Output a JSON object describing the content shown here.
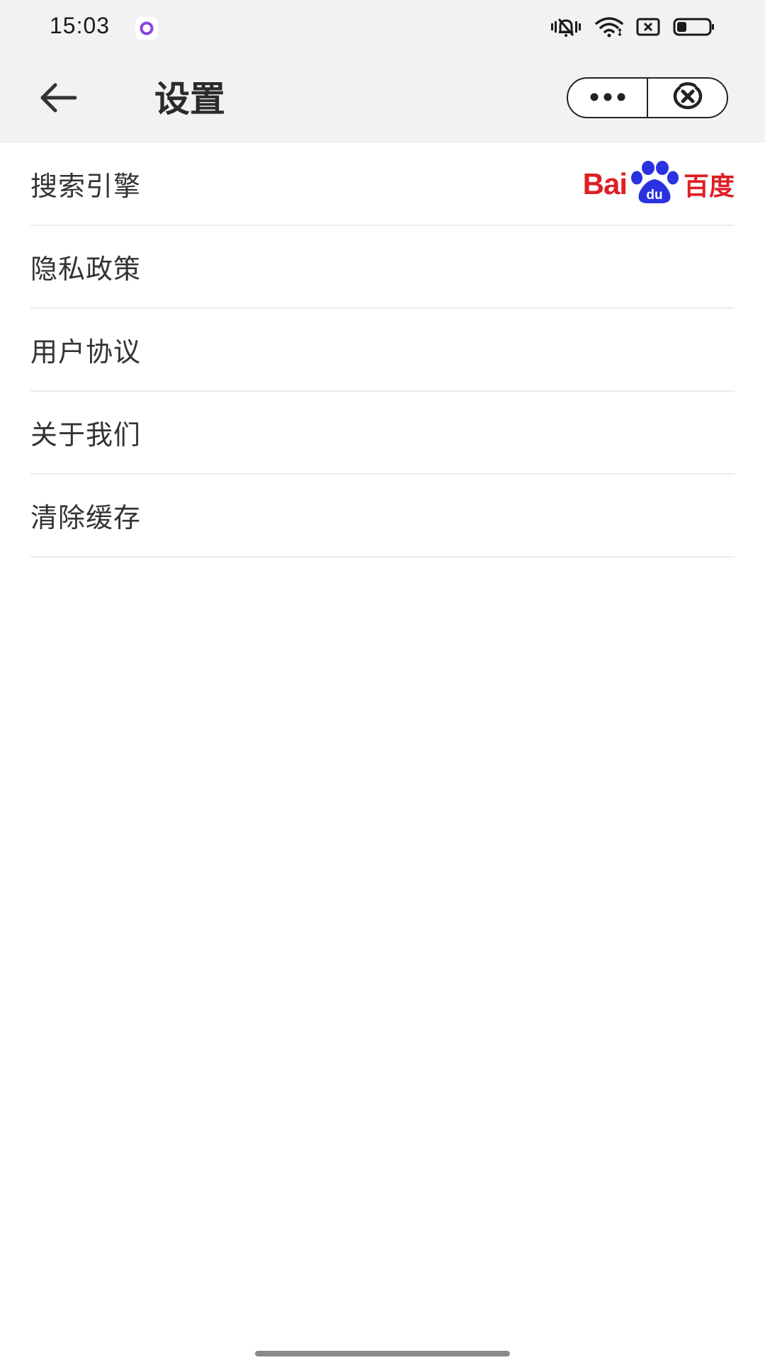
{
  "status_bar": {
    "time": "15:03",
    "icons": [
      "app-notification-icon",
      "vibrate-mute-icon",
      "wifi-icon",
      "sim-card-icon",
      "battery-icon"
    ],
    "battery_level": 0.3
  },
  "nav": {
    "title": "设置",
    "back_icon": "arrow-left-icon",
    "more_icon": "more-dots-icon",
    "close_icon": "close-circle-icon"
  },
  "settings": {
    "items": [
      {
        "label": "搜索引擎",
        "value_logo": "baidu-logo"
      },
      {
        "label": "隐私政策"
      },
      {
        "label": "用户协议"
      },
      {
        "label": "关于我们"
      },
      {
        "label": "清除缓存"
      }
    ],
    "search_engine_logo": {
      "latin": "Bai",
      "paw_text": "du",
      "chinese": "百度"
    }
  },
  "colors": {
    "header_bg": "#f2f2f2",
    "baidu_red": "#de1f26",
    "baidu_blue": "#2932e1",
    "divider": "#ececec"
  }
}
